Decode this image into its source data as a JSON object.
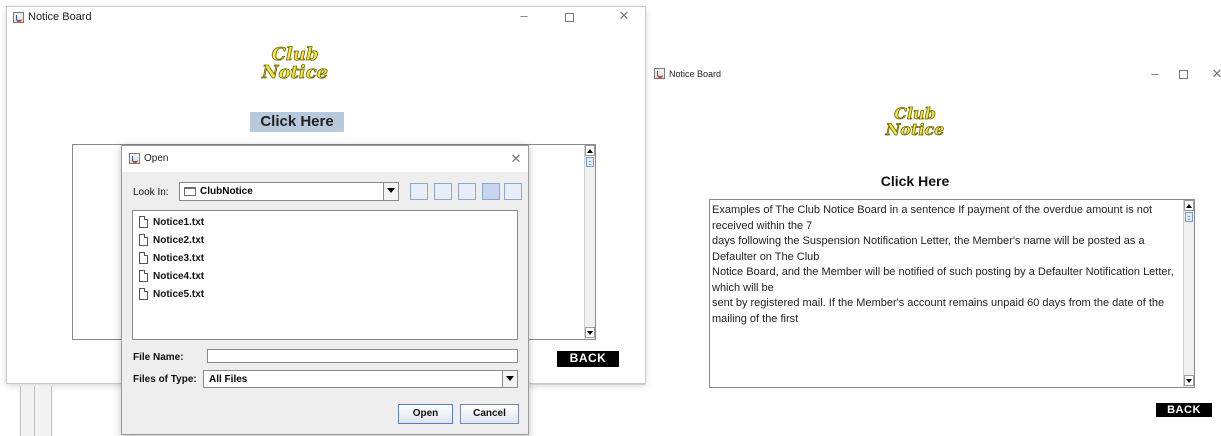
{
  "left_window": {
    "title": "Notice Board",
    "logo_line1": "Club",
    "logo_line2": "Notice",
    "click_here_label": "Click Here",
    "back_label": "BACK"
  },
  "open_dialog": {
    "title": "Open",
    "look_in_label": "Look In:",
    "look_in_value": "ClubNotice",
    "files": [
      "Notice1.txt",
      "Notice2.txt",
      "Notice3.txt",
      "Notice4.txt",
      "Notice5.txt"
    ],
    "file_name_label": "File Name:",
    "file_name_value": "",
    "files_of_type_label": "Files of Type:",
    "files_of_type_value": "All Files",
    "open_button": "Open",
    "cancel_button": "Cancel"
  },
  "right_window": {
    "title": "Notice Board",
    "logo_line1": "Club",
    "logo_line2": "Notice",
    "click_here_label": "Click Here",
    "notice_text": "Examples of The Club Notice Board in a sentence If payment of the overdue amount is not received within the 7\n days following the Suspension Notification Letter, the Member's name will be posted as a Defaulter on The Club\n Notice Board, and the Member will be notified of such posting by a Defaulter Notification Letter, which will be\n sent by registered mail. If the Member's account remains unpaid 60 days from the date of the mailing of the first",
    "back_label": "BACK"
  },
  "colors": {
    "logo_fill": "#f5e642",
    "button_highlight": "#b8c9dc",
    "back_bg": "#000000"
  }
}
